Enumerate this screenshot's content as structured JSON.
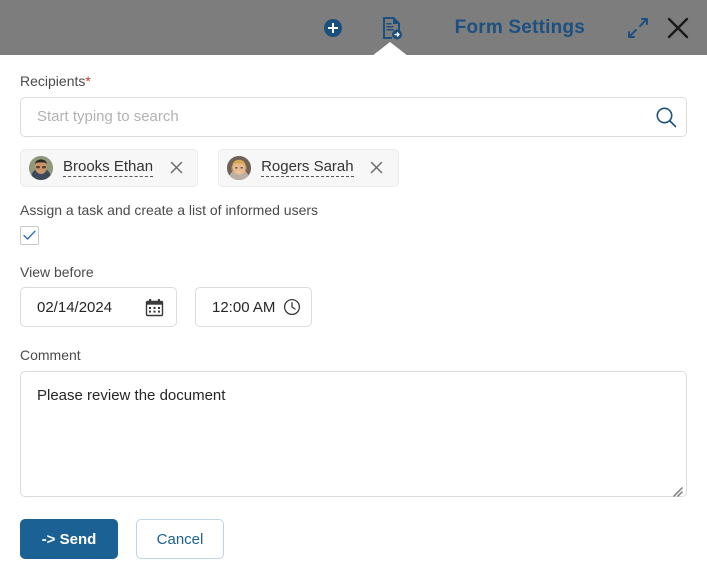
{
  "header": {
    "title": "Form Settings",
    "icons": {
      "add": "plus-circle-icon",
      "document": "document-share-icon",
      "expand": "expand-diagonal-icon",
      "close": "close-icon"
    }
  },
  "form": {
    "recipients": {
      "label": "Recipients",
      "required_marker": "*",
      "search_placeholder": "Start typing to search",
      "search_value": "",
      "search_icon": "search-icon",
      "chips": [
        {
          "name": "Brooks Ethan",
          "remove_icon": "close-icon"
        },
        {
          "name": "Rogers Sarah",
          "remove_icon": "close-icon"
        }
      ]
    },
    "assign_task": {
      "label": "Assign a task and create a list of informed users",
      "checked": true
    },
    "view_before": {
      "label": "View before",
      "date_value": "02/14/2024",
      "date_icon": "calendar-icon",
      "time_value": "12:00 AM",
      "time_icon": "clock-icon"
    },
    "comment": {
      "label": "Comment",
      "value": "Please review the document",
      "placeholder": ""
    },
    "actions": {
      "send_label": "-> Send",
      "cancel_label": "Cancel"
    }
  },
  "colors": {
    "header_bg": "#7d7d7d",
    "accent_blue": "#1b6194",
    "title_blue": "#1b5080",
    "required_red": "#d9342b",
    "border_gray": "#dcdcdc"
  }
}
